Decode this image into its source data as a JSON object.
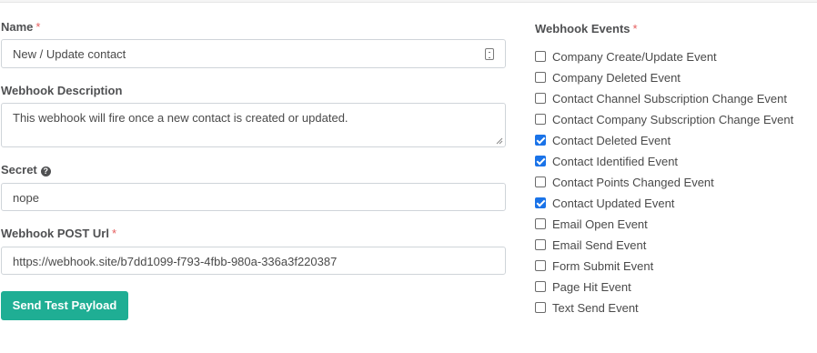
{
  "form": {
    "name_label": "Name",
    "required_mark": "*",
    "name_value": "New / Update contact",
    "description_label": "Webhook Description",
    "description_value": "This webhook will fire once a new contact is created or updated.",
    "secret_label": "Secret",
    "secret_value": "nope",
    "url_label": "Webhook POST Url",
    "url_value": "https://webhook.site/b7dd1099-f793-4fbb-980a-336a3f220387",
    "send_button_label": "Send Test Payload",
    "help_icon": "question-circle-icon",
    "name_field_icon": "form-icon"
  },
  "events": {
    "title": "Webhook Events",
    "items": [
      {
        "label": "Company Create/Update Event",
        "checked": false
      },
      {
        "label": "Company Deleted Event",
        "checked": false
      },
      {
        "label": "Contact Channel Subscription Change Event",
        "checked": false
      },
      {
        "label": "Contact Company Subscription Change Event",
        "checked": false
      },
      {
        "label": "Contact Deleted Event",
        "checked": true
      },
      {
        "label": "Contact Identified Event",
        "checked": true
      },
      {
        "label": "Contact Points Changed Event",
        "checked": false
      },
      {
        "label": "Contact Updated Event",
        "checked": true
      },
      {
        "label": "Email Open Event",
        "checked": false
      },
      {
        "label": "Email Send Event",
        "checked": false
      },
      {
        "label": "Form Submit Event",
        "checked": false
      },
      {
        "label": "Page Hit Event",
        "checked": false
      },
      {
        "label": "Text Send Event",
        "checked": false
      }
    ]
  },
  "colors": {
    "accent": "#1fae94",
    "required": "#e55d5d",
    "checkbox_checked": "#1a73e8"
  }
}
